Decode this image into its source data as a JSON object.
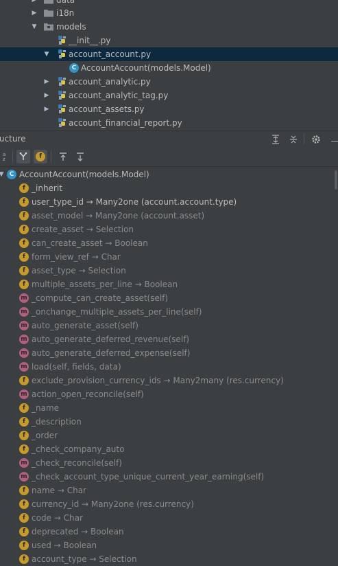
{
  "project_tree": {
    "items": [
      {
        "label": "data",
        "kind": "folder",
        "expanded": false
      },
      {
        "label": "i18n",
        "kind": "folder",
        "expanded": false
      },
      {
        "label": "models",
        "kind": "folder",
        "expanded": true
      },
      {
        "label": "__init__.py",
        "kind": "python-file"
      },
      {
        "label": "account_account.py",
        "kind": "python-file",
        "expanded": true,
        "selected": true
      },
      {
        "label": "AccountAccount(models.Model)",
        "kind": "class"
      },
      {
        "label": "account_analytic.py",
        "kind": "python-file",
        "expanded": false
      },
      {
        "label": "account_analytic_tag.py",
        "kind": "python-file",
        "expanded": false
      },
      {
        "label": "account_assets.py",
        "kind": "python-file",
        "expanded": false
      },
      {
        "label": "account_financial_report.py",
        "kind": "python-file"
      }
    ]
  },
  "structure": {
    "title": "ructure",
    "toolbar": {
      "sort_alpha_label": "a z"
    },
    "root": {
      "label": "AccountAccount(models.Model)"
    },
    "members": [
      {
        "kind": "f",
        "name": "_inherit",
        "type": "",
        "dim": false
      },
      {
        "kind": "f",
        "name": "user_type_id",
        "type": "Many2one (account.account.type)",
        "dim": false
      },
      {
        "kind": "f",
        "name": "asset_model",
        "type": "Many2one (account.asset)",
        "dim": true
      },
      {
        "kind": "f",
        "name": "create_asset",
        "type": "Selection",
        "dim": true
      },
      {
        "kind": "f",
        "name": "can_create_asset",
        "type": "Boolean",
        "dim": true
      },
      {
        "kind": "f",
        "name": "form_view_ref",
        "type": "Char",
        "dim": true
      },
      {
        "kind": "f",
        "name": "asset_type",
        "type": "Selection",
        "dim": true
      },
      {
        "kind": "f",
        "name": "multiple_assets_per_line",
        "type": "Boolean",
        "dim": true
      },
      {
        "kind": "m",
        "name": "_compute_can_create_asset(self)",
        "type": "",
        "dim": true
      },
      {
        "kind": "m",
        "name": "_onchange_multiple_assets_per_line(self)",
        "type": "",
        "dim": true
      },
      {
        "kind": "m",
        "name": "auto_generate_asset(self)",
        "type": "",
        "dim": true
      },
      {
        "kind": "m",
        "name": "auto_generate_deferred_revenue(self)",
        "type": "",
        "dim": true
      },
      {
        "kind": "m",
        "name": "auto_generate_deferred_expense(self)",
        "type": "",
        "dim": true
      },
      {
        "kind": "m",
        "name": "load(self, fields, data)",
        "type": "",
        "dim": true
      },
      {
        "kind": "f",
        "name": "exclude_provision_currency_ids",
        "type": "Many2many (res.currency)",
        "dim": true
      },
      {
        "kind": "m",
        "name": "action_open_reconcile(self)",
        "type": "",
        "dim": true
      },
      {
        "kind": "f",
        "name": "_name",
        "type": "",
        "dim": true
      },
      {
        "kind": "f",
        "name": "_description",
        "type": "",
        "dim": true
      },
      {
        "kind": "f",
        "name": "_order",
        "type": "",
        "dim": true
      },
      {
        "kind": "f",
        "name": "_check_company_auto",
        "type": "",
        "dim": true
      },
      {
        "kind": "m",
        "name": "_check_reconcile(self)",
        "type": "",
        "dim": true
      },
      {
        "kind": "m",
        "name": "_check_account_type_unique_current_year_earning(self)",
        "type": "",
        "dim": true
      },
      {
        "kind": "f",
        "name": "name",
        "type": "Char",
        "dim": true
      },
      {
        "kind": "f",
        "name": "currency_id",
        "type": "Many2one (res.currency)",
        "dim": true
      },
      {
        "kind": "f",
        "name": "code",
        "type": "Char",
        "dim": true
      },
      {
        "kind": "f",
        "name": "deprecated",
        "type": "Boolean",
        "dim": true
      },
      {
        "kind": "f",
        "name": "used",
        "type": "Boolean",
        "dim": true
      },
      {
        "kind": "f",
        "name": "account_type",
        "type": "Selection",
        "dim": true
      }
    ],
    "arrow_glyph": "→"
  },
  "colors": {
    "background": "#3c3f41",
    "selection": "#0d293e",
    "field_icon": "#c69a2b",
    "method_icon": "#b0607e",
    "class_icon": "#3592c4"
  }
}
